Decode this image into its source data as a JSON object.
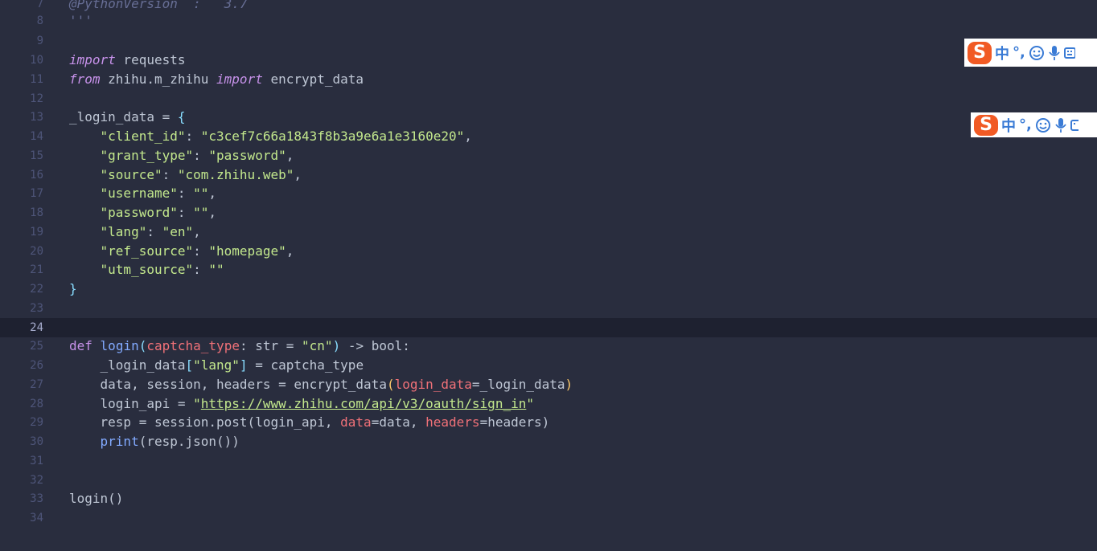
{
  "line_numbers": [
    "7",
    "8",
    "9",
    "10",
    "11",
    "12",
    "13",
    "14",
    "15",
    "16",
    "17",
    "18",
    "19",
    "20",
    "21",
    "22",
    "23",
    "24",
    "25",
    "26",
    "27",
    "28",
    "29",
    "30",
    "31",
    "32",
    "33",
    "34"
  ],
  "code": {
    "l7": {
      "text": "@PythonVersion  :   3.7"
    },
    "l8": {
      "text": "'''"
    },
    "l10": {
      "kw": "import",
      "rest": " requests"
    },
    "l11": {
      "kw1": "from",
      "mod": " zhihu.m_zhihu ",
      "kw2": "import",
      "rest": " encrypt_data"
    },
    "l13": {
      "name": "_login_data = ",
      "brace": "{"
    },
    "dict": [
      {
        "key": "\"client_id\"",
        "value": "\"c3cef7c66a1843f8b3a9e6a1e3160e20\"",
        "tail": ","
      },
      {
        "key": "\"grant_type\"",
        "value": "\"password\"",
        "tail": ","
      },
      {
        "key": "\"source\"",
        "value": "\"com.zhihu.web\"",
        "tail": ","
      },
      {
        "key": "\"username\"",
        "value": "\"\"",
        "tail": ","
      },
      {
        "key": "\"password\"",
        "value": "\"\"",
        "tail": ","
      },
      {
        "key": "\"lang\"",
        "value": "\"en\"",
        "tail": ","
      },
      {
        "key": "\"ref_source\"",
        "value": "\"homepage\"",
        "tail": ","
      },
      {
        "key": "\"utm_source\"",
        "value": "\"\"",
        "tail": ""
      }
    ],
    "l22": {
      "brace": "}"
    },
    "l25": {
      "def": "def",
      "fn": "login",
      "p_open": "(",
      "param": "captcha_type",
      "colon": ": ",
      "type": "str",
      "eq": " = ",
      "default": "\"cn\"",
      "p_close": ")",
      "arrow": " -> ",
      "ret": "bool",
      "end": ":"
    },
    "l26": {
      "a": "_login_data",
      "b": "[",
      "c": "\"lang\"",
      "d": "]",
      "e": " = captcha_type"
    },
    "l27": {
      "a": "data, session, headers = encrypt_data",
      "b": "(",
      "c": "login_data",
      "d": "=_login_data",
      "e": ")"
    },
    "l28": {
      "a": "login_api = ",
      "q1": "\"",
      "url": "https://www.zhihu.com/api/v3/oauth/sign_in",
      "q2": "\""
    },
    "l29": {
      "a": "resp = session.post(login_api, ",
      "k1": "data",
      "b": "=data, ",
      "k2": "headers",
      "c": "=headers)"
    },
    "l30": {
      "fn": "print",
      "rest": "(resp.json())"
    },
    "l33": {
      "text": "login()"
    }
  },
  "ime_toolbar": {
    "logo_letter": "S",
    "lang_label": "中",
    "punct_label": "°,",
    "icons": [
      "emoji-icon",
      "microphone-icon",
      "keyboard-icon"
    ]
  }
}
